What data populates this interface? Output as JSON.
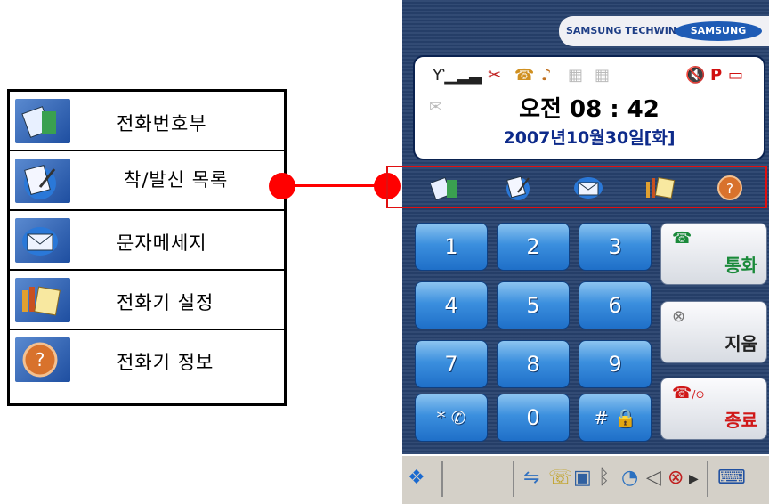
{
  "legend": {
    "items": [
      {
        "label": "전화번호부",
        "icon": "phonebook-icon"
      },
      {
        "label": "착/발신 목록",
        "icon": "call-log-icon"
      },
      {
        "label": "문자메세지",
        "icon": "message-icon"
      },
      {
        "label": "전화기 설정",
        "icon": "settings-icon"
      },
      {
        "label": "전화기 정보",
        "icon": "info-icon"
      }
    ]
  },
  "phone": {
    "brand": "SAMSUNG TECHWIN",
    "logo": "SAMSUNG",
    "clock": "오전 08 : 42",
    "date": "2007년10월30일[화]",
    "keys": [
      "1",
      "2",
      "3",
      "4",
      "5",
      "6",
      "7",
      "8",
      "9",
      "* ✆",
      "0",
      "# 🔒"
    ],
    "call_label": "통화",
    "clear_label": "지움",
    "end_label": "종료",
    "end_prefix": "/⊙"
  },
  "colors": {
    "accent": "#ff0000",
    "phone_bg": "#27416d",
    "key_blue": "#3b8fde",
    "call_green": "#1a8a3a",
    "end_red": "#d01818"
  }
}
